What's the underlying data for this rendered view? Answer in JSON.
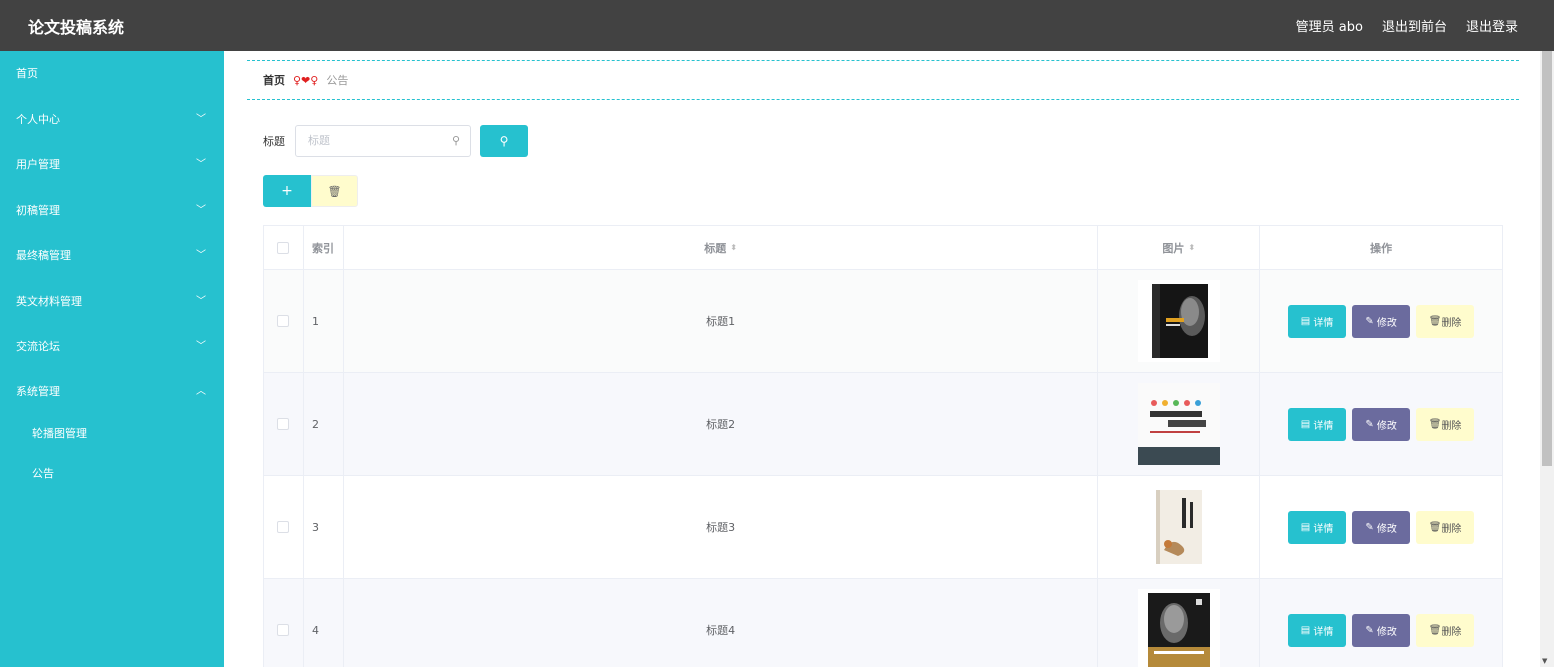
{
  "header": {
    "title": "论文投稿系统",
    "user": "管理员 abo",
    "to_front": "退出到前台",
    "logout": "退出登录"
  },
  "sidebar": {
    "items": [
      {
        "label": "首页"
      },
      {
        "label": "个人中心"
      },
      {
        "label": "用户管理"
      },
      {
        "label": "初稿管理"
      },
      {
        "label": "最终稿管理"
      },
      {
        "label": "英文材料管理"
      },
      {
        "label": "交流论坛"
      },
      {
        "label": "系统管理"
      }
    ],
    "sub_items": [
      {
        "label": "轮播图管理"
      },
      {
        "label": "公告"
      }
    ],
    "chev_down": "﹀",
    "chev_up": "︿"
  },
  "breadcrumb": {
    "home": "首页",
    "sep": "♀❤♀",
    "current": "公告"
  },
  "search": {
    "label": "标题",
    "placeholder": "标题"
  },
  "table": {
    "headers": {
      "index": "索引",
      "title": "标题",
      "image": "图片",
      "ops": "操作"
    },
    "rows": [
      {
        "index": "1",
        "title": "标题1"
      },
      {
        "index": "2",
        "title": "标题2"
      },
      {
        "index": "3",
        "title": "标题3"
      },
      {
        "index": "4",
        "title": "标题4"
      }
    ],
    "ops": {
      "detail": "详情",
      "edit": "修改",
      "delete": "删除"
    }
  },
  "icons": {
    "search": "⚲",
    "add": "+",
    "trash": "🗑",
    "sort": "⬍"
  },
  "colors": {
    "accent": "#26c1cf",
    "header": "#424242",
    "edit": "#6b6b9e",
    "delete": "#fffccd"
  }
}
